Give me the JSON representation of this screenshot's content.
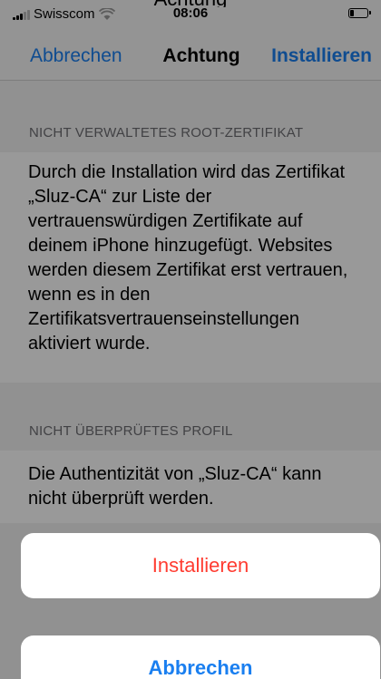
{
  "status_bar": {
    "carrier": "Swisscom",
    "time": "08:06",
    "top_fragment": "Achtung"
  },
  "nav": {
    "cancel_label": "Abbrechen",
    "title": "Achtung",
    "install_label": "Installieren"
  },
  "sections": [
    {
      "header": "NICHT VERWALTETES ROOT-ZERTIFIKAT",
      "body": "Durch die Installation wird das Zertifikat „Sluz-CA“ zur Liste der vertrauenswürdigen Zertifikate auf deinem iPhone hinzugefügt. Websites werden diesem Zertifikat erst vertrauen, wenn es in den Zertifikatsvertrauenseinstellungen aktiviert wurde."
    },
    {
      "header": "NICHT ÜBERPRÜFTES PROFIL",
      "body": "Die Authentizität von „Sluz-CA“ kann nicht überprüft werden."
    }
  ],
  "action_sheet": {
    "install_label": "Installieren",
    "cancel_label": "Abbrechen"
  },
  "colors": {
    "accent_blue": "#1a7ff0",
    "destructive_red": "#ff3b30"
  },
  "icons": {
    "signal": "signal-bars-icon",
    "wifi": "wifi-icon",
    "battery": "battery-icon"
  }
}
